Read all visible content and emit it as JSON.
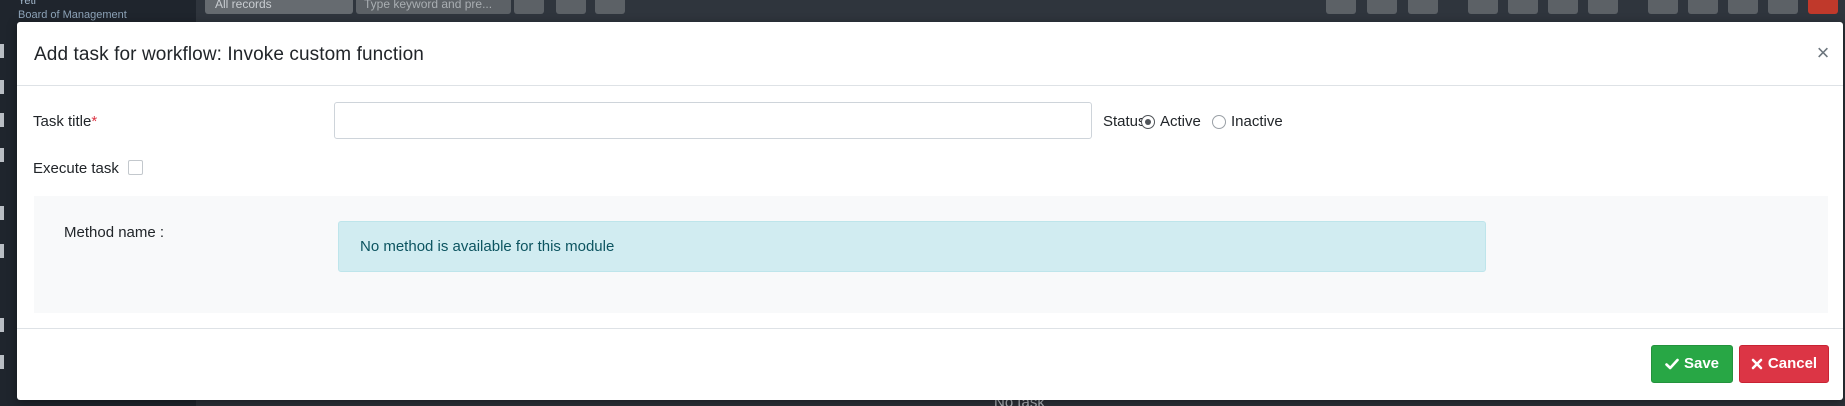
{
  "background": {
    "brand_name": "Yeti",
    "brand_subtitle": "Board of Management",
    "filter_select": "All records",
    "search_placeholder": "Type keyword and pre...",
    "list_empty_text": "No task"
  },
  "modal": {
    "title": "Add task for workflow: Invoke custom function",
    "close_symbol": "×",
    "task_title_label": "Task title",
    "required_mark": "*",
    "task_title_value": "",
    "status_label": "Status",
    "status_options": [
      {
        "label": "Active",
        "checked": true
      },
      {
        "label": "Inactive",
        "checked": false
      }
    ],
    "execute_task_label": "Execute task",
    "execute_task_checked": false,
    "method_name_label": "Method name :",
    "method_message": "No method is available for this module",
    "save_label": "Save",
    "cancel_label": "Cancel"
  },
  "colors": {
    "save": "#28a745",
    "cancel": "#dc3545",
    "info_bg": "#d1ecf1",
    "info_text": "#0c5460",
    "panel_bg": "#f8f9fa"
  },
  "icons": {
    "close": "close-icon",
    "save": "check-icon",
    "cancel": "x-mark-icon"
  }
}
